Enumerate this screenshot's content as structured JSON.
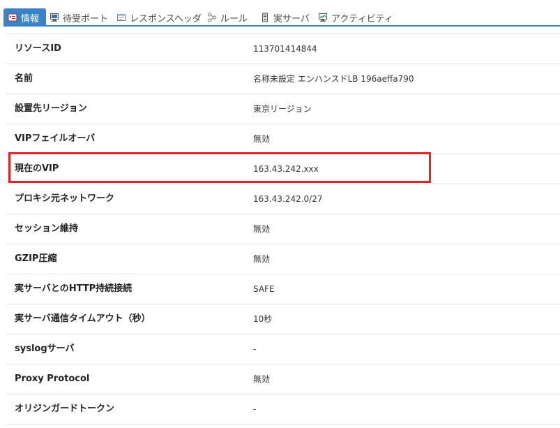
{
  "tabs": [
    {
      "label": "情報",
      "icon": "info-card-icon",
      "active": true
    },
    {
      "label": "待受ポート",
      "icon": "monitor-icon",
      "active": false
    },
    {
      "label": "レスポンスヘッダ",
      "icon": "window-icon",
      "active": false
    },
    {
      "label": "ルール",
      "icon": "branch-icon",
      "active": false
    },
    {
      "label": "実サーバ",
      "icon": "server-icon",
      "active": false
    },
    {
      "label": "アクティビティ",
      "icon": "chart-monitor-icon",
      "active": false
    }
  ],
  "colors": {
    "accent": "#3a83c9",
    "highlight": "#e0202a"
  },
  "rows": [
    {
      "key": "リソースID",
      "value": "113701414844"
    },
    {
      "key": "名前",
      "value": "名称未設定 エンハンスドLB 196aeffa790"
    },
    {
      "key": "設置先リージョン",
      "value": "東京リージョン"
    },
    {
      "key": "VIPフェイルオーバ",
      "value": "無効"
    },
    {
      "key": "現在のVIP",
      "value": "163.43.242.xxx"
    },
    {
      "key": "プロキシ元ネットワーク",
      "value": "163.43.242.0/27"
    },
    {
      "key": "セッション維持",
      "value": "無効"
    },
    {
      "key": "GZIP圧縮",
      "value": "無効"
    },
    {
      "key": "実サーバとのHTTP持続接続",
      "value": "SAFE"
    },
    {
      "key": "実サーバ通信タイムアウト（秒）",
      "value": "10秒"
    },
    {
      "key": "syslogサーバ",
      "value": "-"
    },
    {
      "key": "Proxy Protocol",
      "value": "無効"
    },
    {
      "key": "オリジンガードトークン",
      "value": "-"
    }
  ]
}
